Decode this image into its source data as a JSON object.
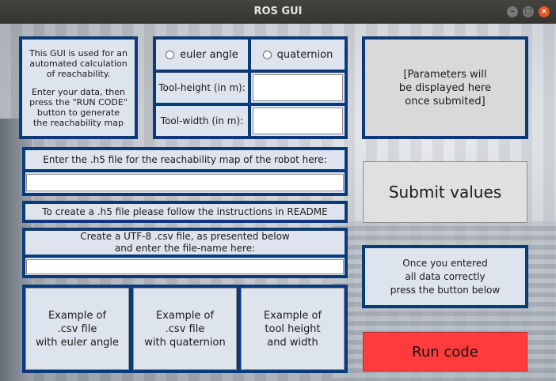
{
  "window": {
    "title": "ROS GUI"
  },
  "intro": {
    "line1": "This GUI is used for an",
    "line2": "automated calculation",
    "line3": "of reachability.",
    "line4": "Enter your data, then",
    "line5": "press the \"RUN CODE\"",
    "line6": "button to generate",
    "line7": "the reachability map"
  },
  "orientation": {
    "euler_label": "euler angle",
    "quaternion_label": "quaternion"
  },
  "tool": {
    "height_label": "Tool-height (in m):",
    "height_value": "",
    "width_label": "Tool-width (in m):",
    "width_value": ""
  },
  "params_display": {
    "line1": "[Parameters will",
    "line2": "be displayed here",
    "line3": "once submited]"
  },
  "h5": {
    "prompt": "Enter the .h5 file for the reachability map of the robot here:",
    "value": "",
    "instructions": "To create a .h5 file please follow the instructions in README"
  },
  "csv": {
    "prompt_line1": "Create a UTF-8 .csv file, as presented below",
    "prompt_line2": "and enter the file-name here:",
    "value": ""
  },
  "examples": [
    {
      "line1": "Example of",
      "line2": ".csv file",
      "line3": "with euler angle"
    },
    {
      "line1": "Example of",
      "line2": ".csv file",
      "line3": "with quaternion"
    },
    {
      "line1": "Example of",
      "line2": "tool height",
      "line3": "and width"
    }
  ],
  "submit": {
    "label": "Submit values"
  },
  "hint": {
    "line1": "Once you entered",
    "line2": "all data correctly",
    "line3": "press the button below"
  },
  "run": {
    "label": "Run code",
    "color": "#ff3b3b"
  },
  "colors": {
    "panel_border": "#0b3a7a",
    "panel_fill": "#dde4ee"
  }
}
